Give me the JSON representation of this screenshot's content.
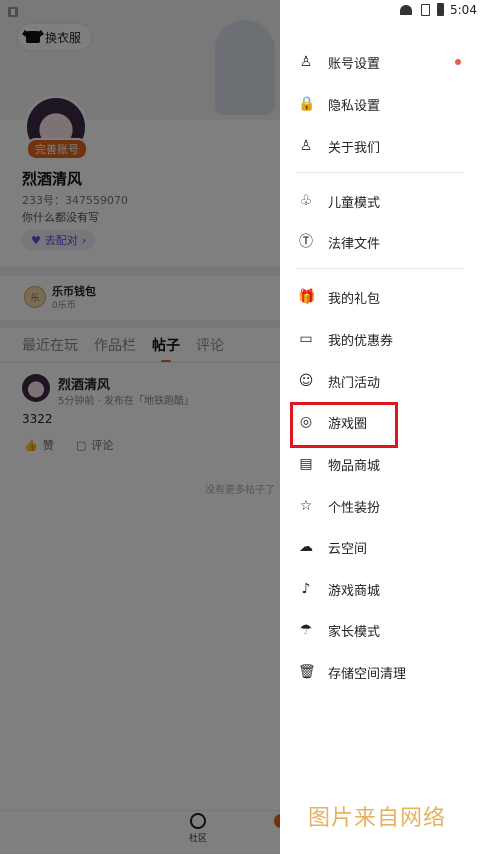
{
  "status_bar": {
    "time": "5:04"
  },
  "profile": {
    "outfit_button": "换衣服",
    "badge": "完善账号",
    "username": "烈酒清风",
    "user_id": "233号：347559070",
    "bio": "你什么都没有写",
    "pair_button": "去配对",
    "wallet": {
      "title": "乐币钱包",
      "balance": "0乐币",
      "icon_text": "乐"
    },
    "tabs": [
      "最近在玩",
      "作品栏",
      "帖子",
      "评论"
    ],
    "post": {
      "author": "烈酒清风",
      "meta": "5分钟前 · 发布在「地铁跑酷」",
      "content": "3322",
      "like_label": "赞",
      "comment_label": "评论"
    },
    "empty_text": "没有更多帖子了",
    "bottom_nav": {
      "community": "社区"
    }
  },
  "drawer": {
    "items": [
      {
        "label": "账号设置",
        "icon": "person-icon",
        "glyph": "♙"
      },
      {
        "label": "隐私设置",
        "icon": "lock-icon",
        "glyph": "🔒"
      },
      {
        "label": "关于我们",
        "icon": "info-person-icon",
        "glyph": "♙"
      },
      {
        "label": "儿童模式",
        "icon": "sprout-icon",
        "glyph": "♧"
      },
      {
        "label": "法律文件",
        "icon": "document-icon",
        "glyph": "Ⓣ"
      },
      {
        "label": "我的礼包",
        "icon": "gift-icon",
        "glyph": "🎁"
      },
      {
        "label": "我的优惠券",
        "icon": "coupon-icon",
        "glyph": "▭"
      },
      {
        "label": "热门活动",
        "icon": "smile-icon",
        "glyph": "☺"
      },
      {
        "label": "游戏圈",
        "icon": "gamepad-icon",
        "glyph": "◎"
      },
      {
        "label": "物品商城",
        "icon": "shop-icon",
        "glyph": "▤"
      },
      {
        "label": "个性装扮",
        "icon": "star-icon",
        "glyph": "☆"
      },
      {
        "label": "云空间",
        "icon": "cloud-icon",
        "glyph": "☁"
      },
      {
        "label": "游戏商城",
        "icon": "music-note-icon",
        "glyph": "♪"
      },
      {
        "label": "家长模式",
        "icon": "umbrella-icon",
        "glyph": "☂"
      },
      {
        "label": "存储空间清理",
        "icon": "trash-icon",
        "glyph": "🗑"
      }
    ],
    "account_settings_has_dot": true,
    "highlight_color": "#e0161e"
  },
  "watermark": "图片来自网络",
  "colors": {
    "accent": "#e3661f",
    "purple": "#5b4ed6"
  }
}
